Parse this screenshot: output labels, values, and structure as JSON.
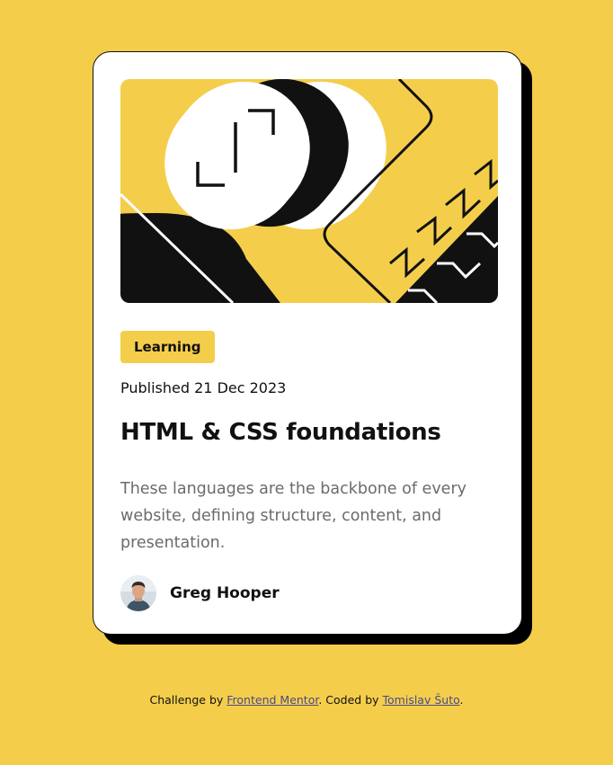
{
  "card": {
    "tag": "Learning",
    "published": "Published 21 Dec 2023",
    "title": "HTML & CSS foundations",
    "description": "These languages are the backbone of every website, defining structure, content, and presentation.",
    "author": {
      "name": "Greg Hooper"
    }
  },
  "footer": {
    "prefix": "Challenge by ",
    "link1": "Frontend Mentor",
    "middle": ". Coded by ",
    "link2": "Tomislav Šuto",
    "suffix": "."
  },
  "colors": {
    "background": "#F4CE4B",
    "card": "#FFFFFF",
    "text": "#111111",
    "muted": "#6B6B6B",
    "shadow": "#000000"
  },
  "icons": {
    "hero": "abstract-illustration",
    "avatar": "author-photo"
  }
}
